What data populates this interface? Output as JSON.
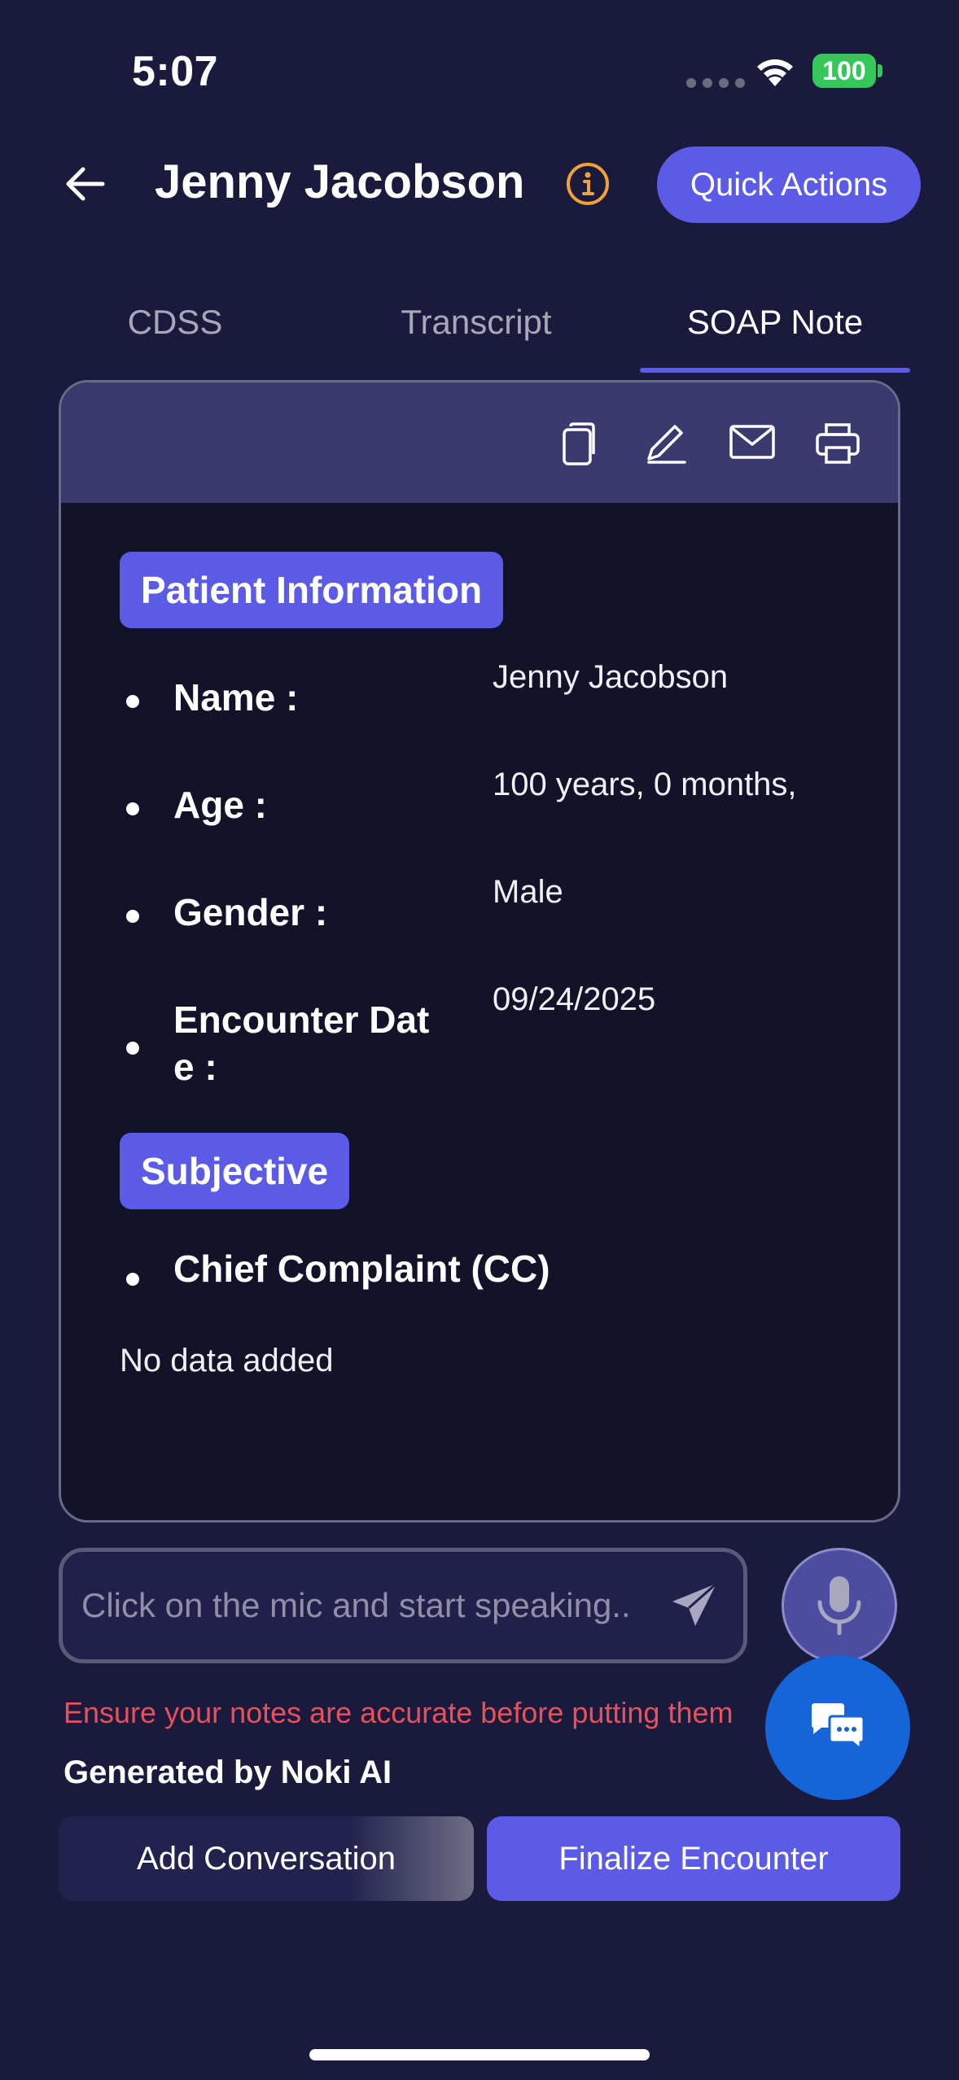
{
  "status_bar": {
    "time": "5:07",
    "battery": "100"
  },
  "header": {
    "patient_name": "Jenny Jacobson",
    "quick_actions_label": "Quick Actions"
  },
  "tabs": [
    {
      "label": "CDSS",
      "active": false
    },
    {
      "label": "Transcript",
      "active": false
    },
    {
      "label": "SOAP Note",
      "active": true
    }
  ],
  "toolbar": {
    "icons": [
      "copy-icon",
      "edit-icon",
      "mail-icon",
      "print-icon"
    ]
  },
  "soap_note": {
    "patient_information": {
      "heading": "Patient Information",
      "fields": [
        {
          "label": "Name :",
          "value": "Jenny Jacobson"
        },
        {
          "label": "Age :",
          "value": "100 years, 0 months,"
        },
        {
          "label": "Gender :",
          "value": "Male"
        },
        {
          "label_line1": "Encounter Dat",
          "label_line2": "e :",
          "value": "09/24/2025"
        }
      ]
    },
    "subjective": {
      "heading": "Subjective",
      "chief_complaint_label": "Chief Complaint (CC)",
      "no_data": "No data added"
    }
  },
  "speech_input": {
    "placeholder": "Click on the mic and start speaking.."
  },
  "disclaimer": "Ensure your notes are accurate before putting them",
  "generated_by": "Generated by Noki AI",
  "actions": {
    "add_conversation": "Add Conversation",
    "finalize_encounter": "Finalize Encounter"
  },
  "colors": {
    "background": "#1a1a3c",
    "accent": "#5b5be8",
    "warning": "#e8505a",
    "info_icon": "#f0a23a",
    "chat_fab": "#1565d8"
  }
}
